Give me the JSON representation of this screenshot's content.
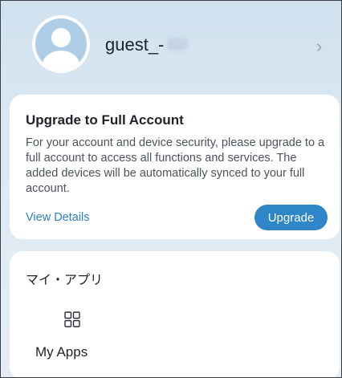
{
  "profile": {
    "username": "guest_-",
    "chevron": "›"
  },
  "upgrade": {
    "title": "Upgrade to Full Account",
    "body": "For your account and device security, please upgrade to a full account to access all functions and services. The added devices will be automatically synced to your full account.",
    "view_details": "View Details",
    "button": "Upgrade"
  },
  "apps": {
    "title": "マイ・アプリ",
    "items": [
      {
        "label": "My Apps",
        "icon": "grid-icon"
      }
    ]
  },
  "colors": {
    "accent": "#2e86c8",
    "link": "#2b82c9",
    "background": "#dbe7f1"
  }
}
